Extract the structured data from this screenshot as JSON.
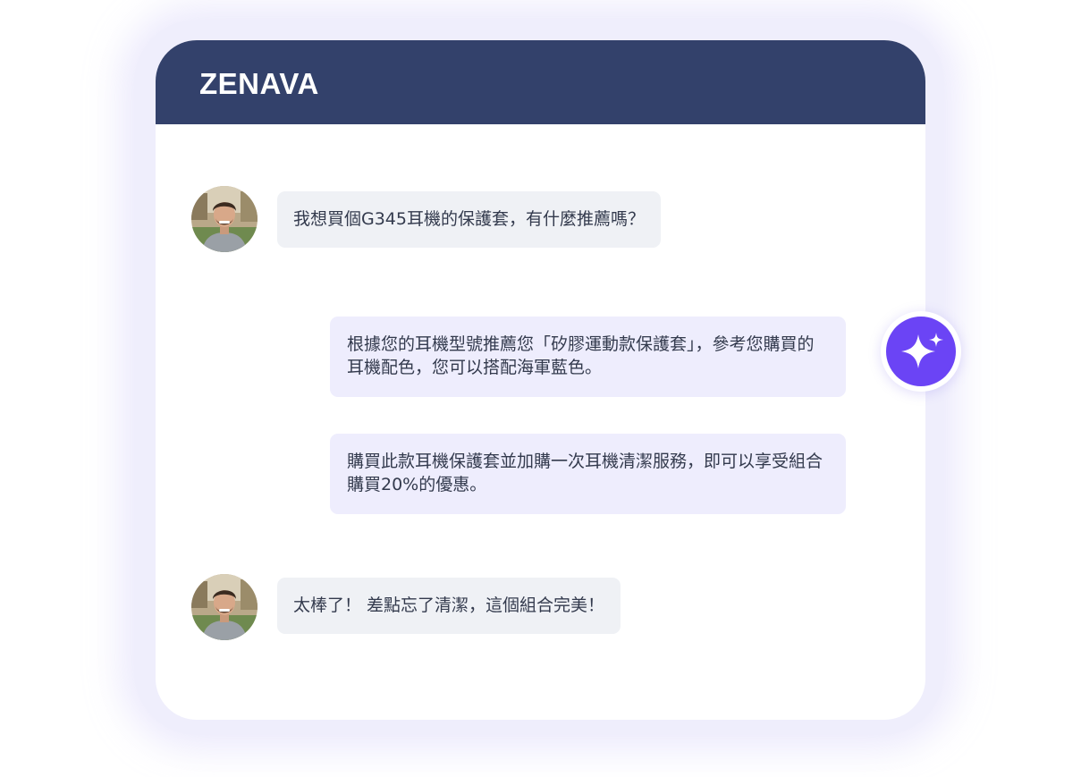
{
  "brand": {
    "name": "ZENAVA"
  },
  "colors": {
    "header": "#33416b",
    "user_bubble": "#eff1f5",
    "bot_bubble": "#eeedfd",
    "ai_accent": "#6b44f5",
    "frame_glow": "#efeefc"
  },
  "chat": {
    "messages": [
      {
        "role": "user",
        "avatar": "user-avatar",
        "text": "我想買個G345耳機的保護套，有什麼推薦嗎？"
      },
      {
        "role": "assistant",
        "text": "根據您的耳機型號推薦您「矽膠運動款保護套」，參考您購買的耳機配色，您可以搭配海軍藍色。"
      },
      {
        "role": "assistant",
        "text": "購買此款耳機保護套並加購一次耳機清潔服務，即可以享受組合購買20%的優惠。"
      },
      {
        "role": "user",
        "avatar": "user-avatar",
        "text": "太棒了！ 差點忘了清潔，這個組合完美！"
      }
    ]
  },
  "ai_badge": {
    "icon": "sparkle-icon"
  }
}
